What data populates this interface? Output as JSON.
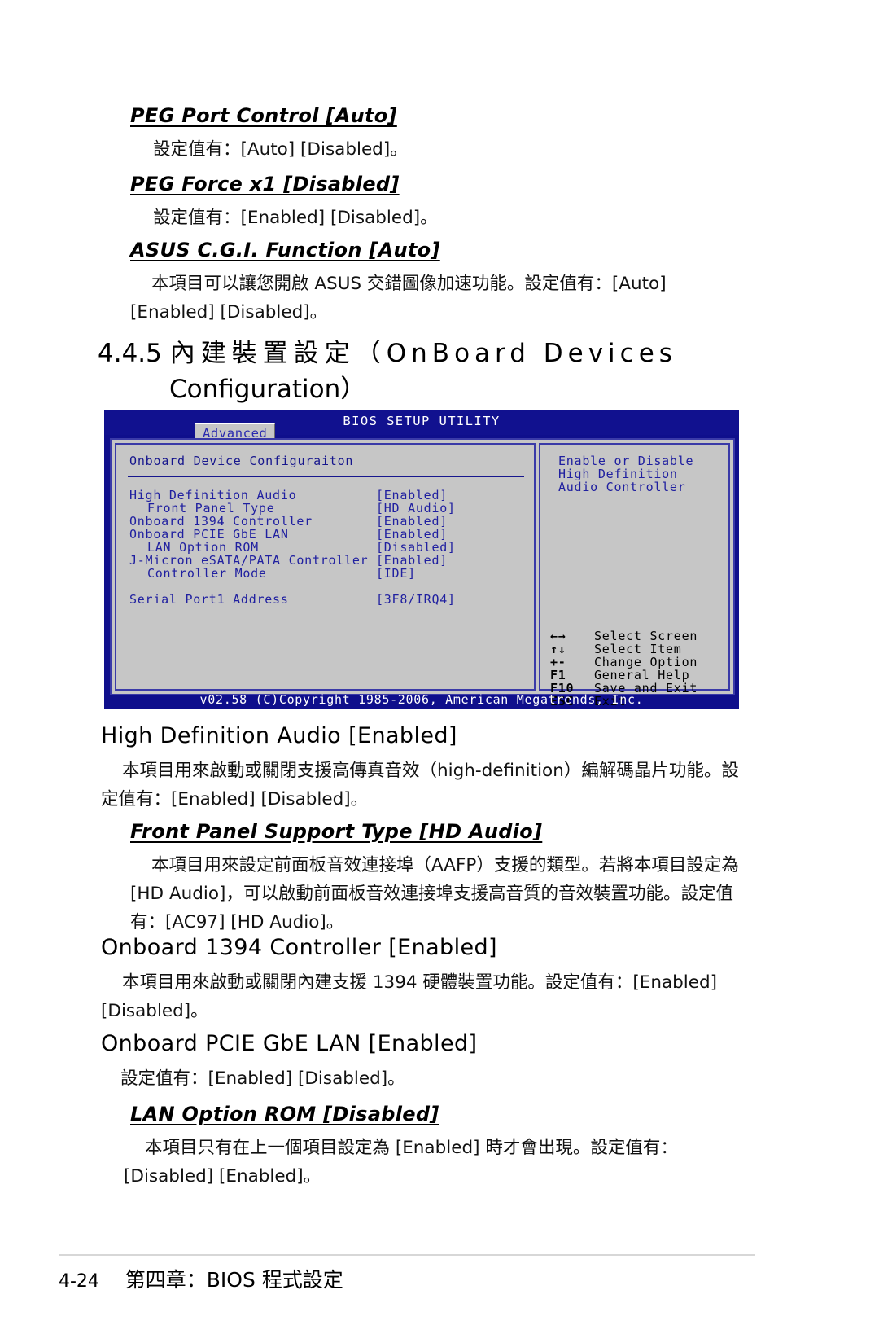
{
  "document": {
    "page_label": "4-24",
    "footer_chapter": "第四章：BIOS 程式設定"
  },
  "top_items": [
    {
      "heading": "PEG Port Control [Auto]",
      "body": "設定值有：[Auto] [Disabled]。"
    },
    {
      "heading": "PEG Force x1 [Disabled]",
      "body": "設定值有：[Enabled] [Disabled]。"
    },
    {
      "heading": "ASUS C.G.I. Function [Auto]",
      "body": "本項目可以讓您開啟 ASUS 交錯圖像加速功能。設定值有：[Auto] [Enabled] [Disabled]。"
    }
  ],
  "section": {
    "number": "4.4.5",
    "title_cjk": "內建裝置設定",
    "title_paren_open": "（",
    "title_eng_line1": "OnBoard  Devices",
    "title_eng_line2": "Configuration",
    "title_paren_close": "）"
  },
  "bios": {
    "title": "BIOS SETUP UTILITY",
    "tab": "Advanced",
    "panel_title": "Onboard Device Configuraiton",
    "rows": [
      {
        "label": "High Definition Audio",
        "value": "[Enabled]",
        "sub": false
      },
      {
        "label": "Front Panel Type",
        "value": "[HD Audio]",
        "sub": true
      },
      {
        "label": "Onboard 1394 Controller",
        "value": "[Enabled]",
        "sub": false
      },
      {
        "label": "Onboard PCIE GbE LAN",
        "value": "[Enabled]",
        "sub": false
      },
      {
        "label": "LAN Option ROM",
        "value": "[Disabled]",
        "sub": true
      },
      {
        "label": "J-Micron eSATA/PATA Controller",
        "value": "[Enabled]",
        "sub": false
      },
      {
        "label": "Controller Mode",
        "value": "[IDE]",
        "sub": true
      },
      {
        "label": "",
        "value": "",
        "sub": false
      },
      {
        "label": "Serial Port1 Address",
        "value": "[3F8/IRQ4]",
        "sub": false
      }
    ],
    "help_text": "Enable or Disable High Definition Audio Controller",
    "legend": [
      {
        "key": "←→",
        "desc": "Select Screen"
      },
      {
        "key": "↑↓",
        "desc": "Select Item"
      },
      {
        "key": "+-",
        "desc": "Change Option"
      },
      {
        "key": "F1",
        "desc": "General Help"
      },
      {
        "key": "F10",
        "desc": "Save and Exit"
      },
      {
        "key": "ESC",
        "desc": "Exit"
      }
    ],
    "footer": "v02.58 (C)Copyright 1985-2006, American Megatrends, Inc.",
    "colors": {
      "titlebar": "#11118f",
      "panel_bg": "#c6c6c6",
      "text_blue": "#2020a0",
      "border_blue": "#3a3aa8"
    }
  },
  "bottom_items": [
    {
      "heading": "High Definition Audio [Enabled]",
      "body": "本項目用來啟動或關閉支援高傳真音效（high-definition）編解碼晶片功能。設定值有：[Enabled] [Disabled]。"
    },
    {
      "heading": "Front Panel Support Type [HD Audio]",
      "body": "本項目用來設定前面板音效連接埠（AAFP）支援的類型。若將本項目設定為 [HD Audio]，可以啟動前面板音效連接埠支援高音質的音效裝置功能。設定值有：[AC97] [HD Audio]。"
    },
    {
      "heading": "Onboard 1394 Controller [Enabled]",
      "body": "本項目用來啟動或關閉內建支援 1394 硬體裝置功能。設定值有：[Enabled] [Disabled]。"
    },
    {
      "heading": "Onboard PCIE GbE LAN [Enabled]",
      "body": "設定值有：[Enabled] [Disabled]。"
    },
    {
      "heading": "LAN Option ROM [Disabled]",
      "body": "本項目只有在上一個項目設定為 [Enabled] 時才會出現。設定值有：[Disabled] [Enabled]。"
    }
  ]
}
